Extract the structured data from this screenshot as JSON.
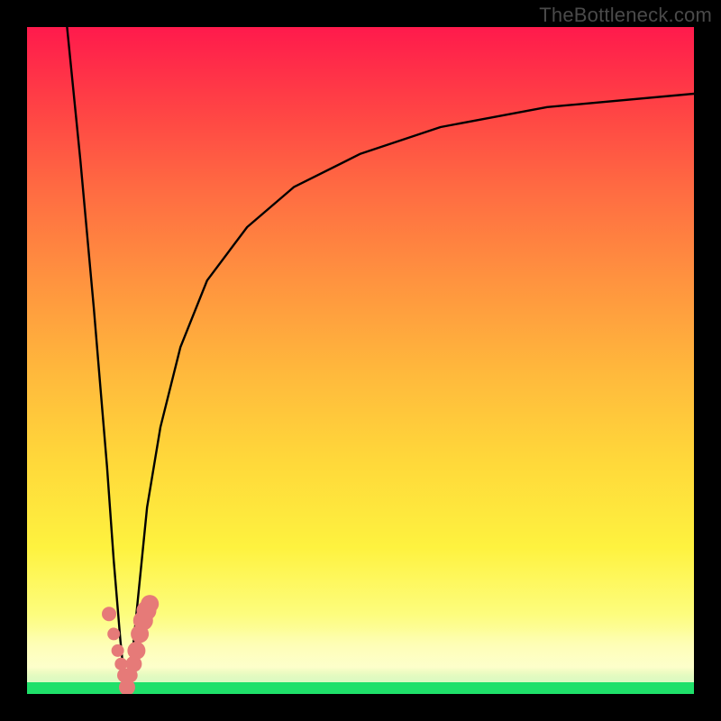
{
  "watermark": "TheBottleneck.com",
  "chart_data": {
    "type": "line",
    "title": "",
    "xlabel": "",
    "ylabel": "",
    "xlim": [
      0,
      100
    ],
    "ylim": [
      0,
      100
    ],
    "grid": false,
    "series": [
      {
        "name": "bottleneck-curve",
        "x": [
          6,
          8,
          10,
          12,
          13,
          14,
          14.5,
          15,
          15.5,
          16,
          17,
          18,
          20,
          23,
          27,
          33,
          40,
          50,
          62,
          78,
          100
        ],
        "values": [
          100,
          80,
          58,
          34,
          20,
          8,
          3,
          1,
          3,
          8,
          18,
          28,
          40,
          52,
          62,
          70,
          76,
          81,
          85,
          88,
          90
        ]
      }
    ],
    "markers": {
      "name": "highlighted-points",
      "color": "#e67a78",
      "x": [
        12.3,
        13.0,
        13.6,
        14.1,
        14.6,
        15.0,
        15.5,
        16.0,
        16.4,
        16.9,
        17.4,
        17.9,
        18.4
      ],
      "values": [
        12.0,
        9.0,
        6.5,
        4.5,
        2.8,
        1.0,
        2.8,
        4.5,
        6.5,
        9.0,
        11.0,
        12.5,
        13.5
      ],
      "size": [
        8,
        7,
        7,
        7,
        8,
        9,
        8,
        9,
        10,
        10,
        11,
        11,
        10
      ]
    },
    "background_gradient": {
      "bottom": "#1fe06a",
      "mid": "#fef23f",
      "top": "#ff1a4c"
    }
  }
}
